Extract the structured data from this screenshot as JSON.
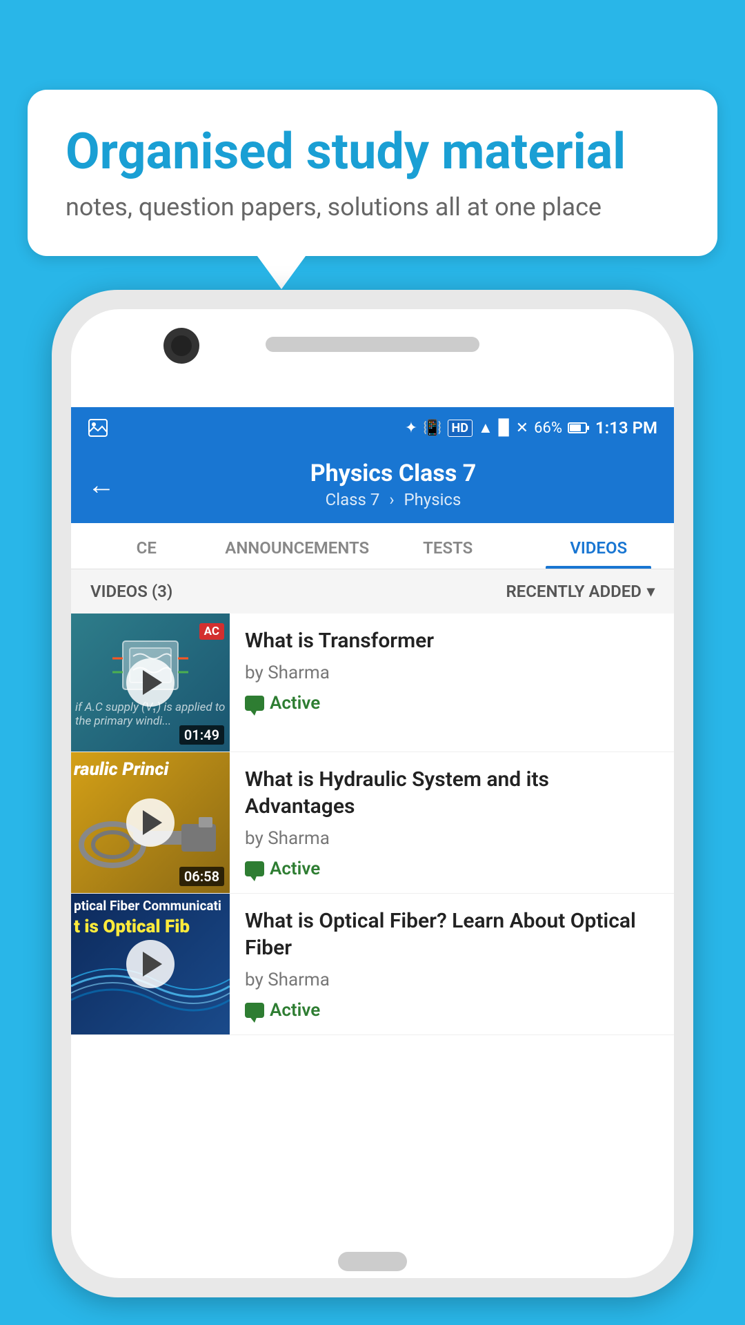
{
  "background_color": "#29b6e8",
  "speech_bubble": {
    "title": "Organised study material",
    "subtitle": "notes, question papers, solutions all at one place"
  },
  "phone": {
    "status_bar": {
      "time": "1:13 PM",
      "battery": "66%",
      "signal_icon": "signal",
      "wifi_icon": "wifi",
      "bluetooth_icon": "bluetooth",
      "hd_badge": "HD"
    },
    "top_bar": {
      "back_label": "←",
      "title": "Physics Class 7",
      "breadcrumb_class": "Class 7",
      "breadcrumb_subject": "Physics"
    },
    "tabs": [
      {
        "label": "CE",
        "active": false
      },
      {
        "label": "ANNOUNCEMENTS",
        "active": false
      },
      {
        "label": "TESTS",
        "active": false
      },
      {
        "label": "VIDEOS",
        "active": true
      }
    ],
    "filter_bar": {
      "count_label": "VIDEOS (3)",
      "sort_label": "RECENTLY ADDED"
    },
    "videos": [
      {
        "title": "What is  Transformer",
        "author": "by Sharma",
        "status": "Active",
        "duration": "01:49",
        "thumb_badge": "AC",
        "thumb_type": "transformer"
      },
      {
        "title": "What is Hydraulic System and its Advantages",
        "author": "by Sharma",
        "status": "Active",
        "duration": "06:58",
        "thumb_text": "raulic Princi",
        "thumb_type": "hydraulic"
      },
      {
        "title": "What is Optical Fiber? Learn About Optical Fiber",
        "author": "by Sharma",
        "status": "Active",
        "duration": "",
        "thumb_text": "ptical Fiber Communicati",
        "thumb_text2": "t is Optical Fib",
        "thumb_type": "optical"
      }
    ]
  }
}
